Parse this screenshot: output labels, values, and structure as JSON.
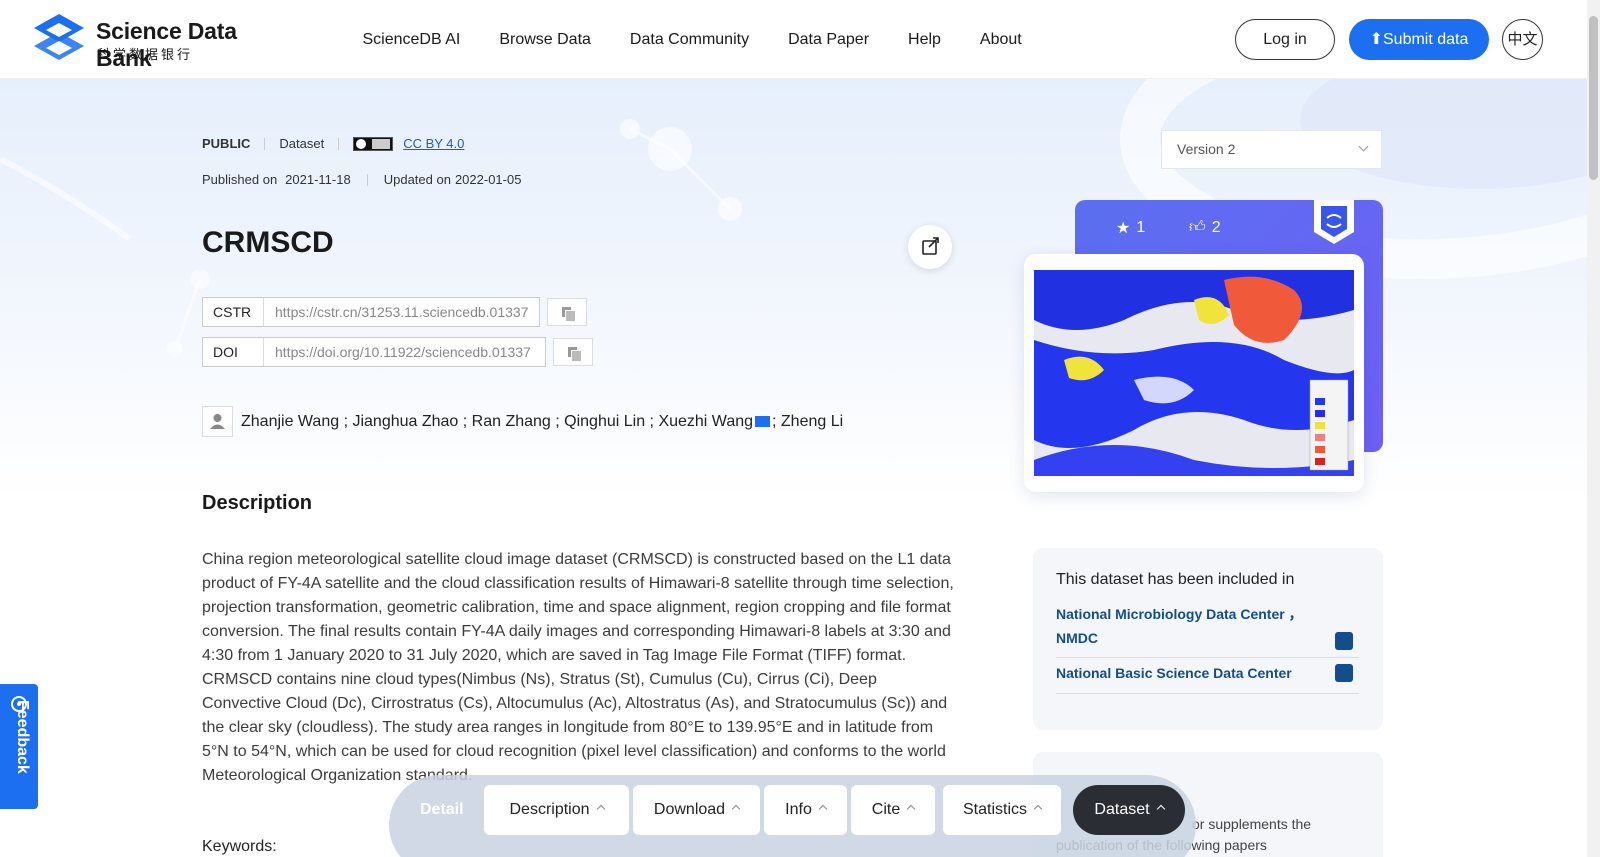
{
  "header": {
    "logo_title": "Science Data Bank",
    "logo_subtitle": "科学数据银行",
    "nav": [
      "ScienceDB AI",
      "Browse Data",
      "Data Community",
      "Data Paper",
      "Help",
      "About"
    ],
    "login_label": "Log in",
    "submit_label": "Submit data",
    "lang_label": "中文"
  },
  "dataset": {
    "visibility": "PUBLIC",
    "type": "Dataset",
    "license": "CC BY 4.0",
    "published_label": "Published on",
    "published_date": "2021-11-18",
    "updated_label": "Updated on",
    "updated_date": "2022-01-05",
    "title": "CRMSCD",
    "cstr_label": "CSTR",
    "cstr_value": "https://cstr.cn/31253.11.sciencedb.01337",
    "doi_label": "DOI",
    "doi_value": "https://doi.org/10.11922/sciencedb.01337",
    "authors_a": "Zhanjie Wang ; Jianghua Zhao ; Ran Zhang ; Qinghui Lin ; Xuezhi Wang",
    "authors_b": "; Zheng Li",
    "version": "Version 2",
    "stars": "1",
    "likes": "2"
  },
  "description": {
    "heading": "Description",
    "text": "China region meteorological satellite cloud image dataset (CRMSCD) is constructed based on the L1 data product of FY-4A satellite and the cloud classification results of Himawari-8 satellite through time selection, projection transformation, geometric calibration, time and space alignment, region cropping and file format conversion. The final results contain FY-4A daily images and corresponding Himawari-8 labels at 3:30 and 4:30 from 1 January 2020 to 31 July 2020, which are saved in Tag Image File Format (TIFF) format. CRMSCD contains nine cloud types(Nimbus (Ns), Stratus (St), Cumulus (Cu), Cirrus (Ci), Deep Convective Cloud (Dc), Cirrostratus (Cs), Altocumulus (Ac), Altostratus (As), and Stratocumulus (Sc)) and the clear sky (cloudless). The study area ranges in longitude from 80°E to 139.95°E and in latitude from 5°N to 54°N, which can be used for cloud recognition (pixel level classification) and conforms to the world Meteorological Organization standard.",
    "keywords_label": "Keywords:"
  },
  "included": {
    "heading": "This dataset has been included in",
    "items": [
      "National Microbiology Data Center ， NMDC",
      "National Basic Science Data Center"
    ]
  },
  "card2": {
    "text_a": "or supplements the",
    "text_b": "publication of the following papers"
  },
  "feedback_label": "Feedback",
  "dock": {
    "detail": "Detail",
    "tabs": [
      "Description",
      "Download",
      "Info",
      "Cite",
      "Statistics",
      "Dataset"
    ]
  },
  "colors": {
    "brand": "#1b6ff0",
    "link": "#134d8b",
    "card": "#6d5ff5"
  }
}
